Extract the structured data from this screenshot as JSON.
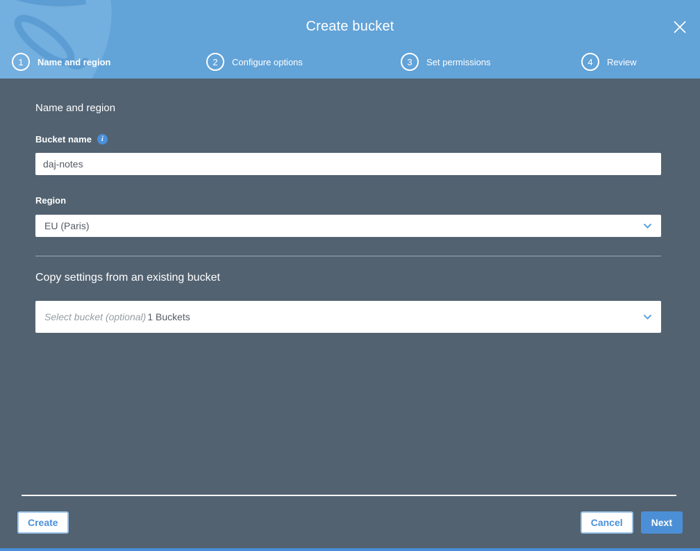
{
  "modal": {
    "title": "Create bucket"
  },
  "steps": [
    {
      "number": "1",
      "label": "Name and region",
      "active": true
    },
    {
      "number": "2",
      "label": "Configure options",
      "active": false
    },
    {
      "number": "3",
      "label": "Set permissions",
      "active": false
    },
    {
      "number": "4",
      "label": "Review",
      "active": false
    }
  ],
  "form": {
    "section_heading": "Name and region",
    "bucket_name": {
      "label": "Bucket name",
      "value": "daj-notes"
    },
    "region": {
      "label": "Region",
      "selected": "EU (Paris)"
    },
    "copy_settings": {
      "heading": "Copy settings from an existing bucket",
      "placeholder": "Select bucket (optional)",
      "buckets_count": "1 Buckets"
    }
  },
  "footer": {
    "create": "Create",
    "cancel": "Cancel",
    "next": "Next"
  },
  "icons": {
    "close": "x-close",
    "info": "i",
    "chevron_down": "chevron-down",
    "watermark": "s3-bucket"
  },
  "colors": {
    "header_bg": "#62A3D8",
    "body_bg": "#526271",
    "accent_blue": "#4A90D9",
    "primary_button_bg": "#4B8FD6",
    "input_text": "#545B64",
    "bottom_strip": "#4A90D9"
  }
}
